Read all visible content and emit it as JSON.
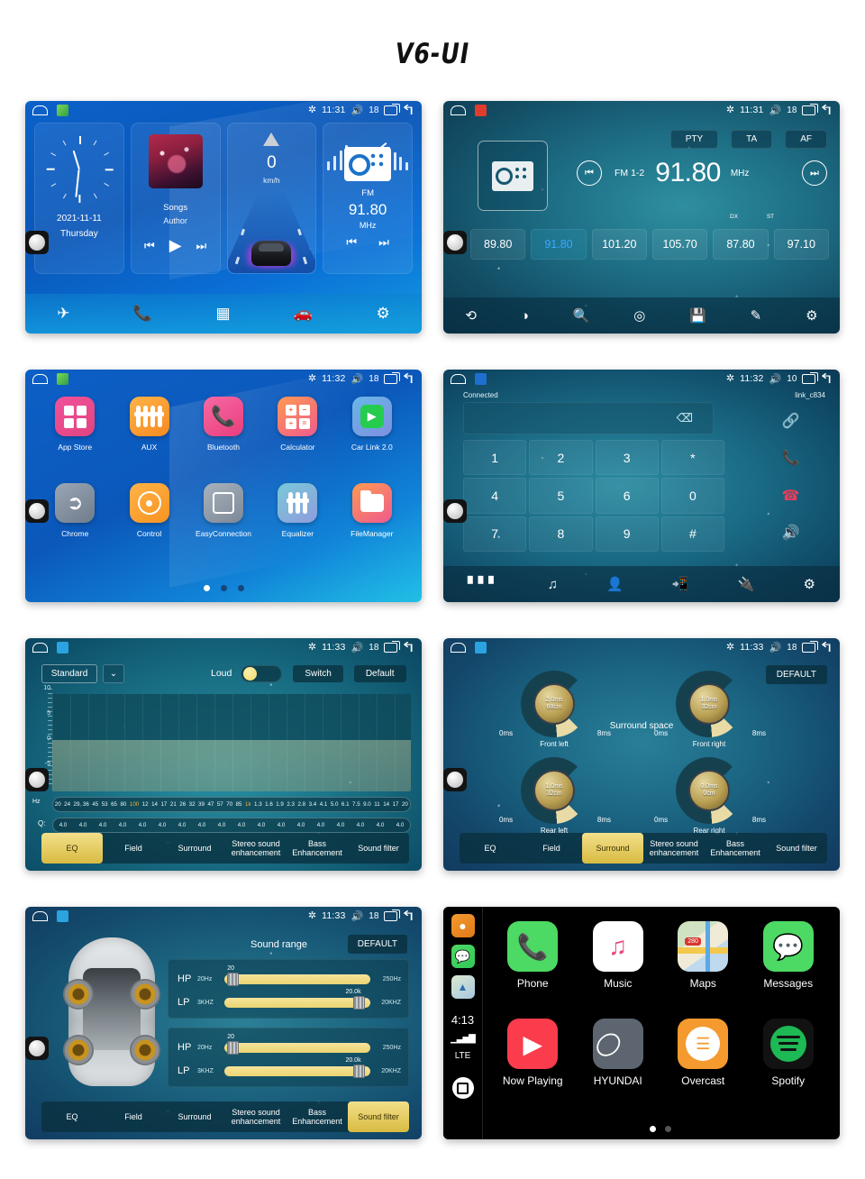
{
  "title": "V6-UI",
  "panels": {
    "home": {
      "status": {
        "time": "11:31",
        "volume": "18",
        "bt_icon": "bluetooth-icon",
        "vol_icon": "volume-icon"
      },
      "clock": {
        "date": "2021-11-11",
        "weekday": "Thursday"
      },
      "music": {
        "song": "Songs",
        "artist": "Author"
      },
      "nav": {
        "speed": "0",
        "unit": "km/h"
      },
      "radio": {
        "band": "FM",
        "freq": "91.80",
        "unit": "MHz"
      },
      "dock": [
        "navigation-icon",
        "phone-icon",
        "apps-icon",
        "carlink-icon",
        "settings-icon"
      ]
    },
    "radio": {
      "status": {
        "time": "11:31",
        "volume": "18"
      },
      "buttons": [
        "PTY",
        "TA",
        "AF"
      ],
      "band": "FM 1-2",
      "frequency": "91.80",
      "unit": "MHz",
      "dx": "DX",
      "st": "ST",
      "presets": [
        "89.80",
        "91.80",
        "101.20",
        "105.70",
        "87.80",
        "97.10"
      ],
      "active_preset_index": 1,
      "dock": [
        "scan-icon",
        "mode-icon",
        "search-icon",
        "location-icon",
        "save-icon",
        "edit-icon",
        "settings-icon"
      ]
    },
    "apps": {
      "status": {
        "time": "11:32",
        "volume": "18"
      },
      "items": [
        {
          "label": "App Store",
          "icon": "grid-icon",
          "color1": "#f0529b",
          "color2": "#e2437f"
        },
        {
          "label": "AUX",
          "icon": "sliders-icon",
          "color1": "#ffb347",
          "color2": "#f58a21"
        },
        {
          "label": "Bluetooth",
          "icon": "phone-icon",
          "color1": "#f56aa3",
          "color2": "#ea3d7d"
        },
        {
          "label": "Calculator",
          "icon": "calculator-icon",
          "color1": "#ff9a52",
          "color2": "#ee5a8e"
        },
        {
          "label": "Car Link 2.0",
          "icon": "play-icon",
          "color1": "#67b7e8",
          "color2": "#7f8fe0"
        },
        {
          "label": "Chrome",
          "icon": "compass-icon",
          "color1": "#9aa6b4",
          "color2": "#6f7c8c"
        },
        {
          "label": "Control",
          "icon": "steering-wheel-icon",
          "color1": "#ffb347",
          "color2": "#f79321"
        },
        {
          "label": "EasyConnection",
          "icon": "screen-share-icon",
          "color1": "#a7b2bd",
          "color2": "#7d8896"
        },
        {
          "label": "Equalizer",
          "icon": "equalizer-icon",
          "color1": "#79c8d8",
          "color2": "#8f9ddd"
        },
        {
          "label": "FileManager",
          "icon": "folder-icon",
          "color1": "#ff9a52",
          "color2": "#ee5a8e"
        }
      ],
      "page_dots": 3,
      "active_dot": 0
    },
    "dialer": {
      "status": {
        "time": "11:32",
        "volume": "10"
      },
      "connection_status": "Connected",
      "device_name": "link_c834",
      "input_value": "",
      "keys": [
        "1",
        "2",
        "3",
        "*",
        "4",
        "5",
        "6",
        "0",
        "7",
        "8",
        "9",
        "#"
      ],
      "side_buttons": [
        "link-icon",
        "call-answer-icon",
        "call-end-icon",
        "speaker-icon"
      ],
      "dock": [
        "dialpad-icon",
        "music-icon",
        "contacts-icon",
        "call-log-icon",
        "connect-icon",
        "settings-icon"
      ]
    },
    "eq": {
      "status": {
        "time": "11:33",
        "volume": "18"
      },
      "preset": "Standard",
      "loud_label": "Loud",
      "loud_on": true,
      "switch_label": "Switch",
      "default_label": "Default",
      "y_axis": [
        "10",
        "5",
        "0",
        "-5"
      ],
      "hz_label": "Hz",
      "q_label": "Q:",
      "frequencies": [
        "20",
        "24",
        "29",
        "36",
        "45",
        "53",
        "65",
        "80",
        "100",
        "12",
        "14",
        "17",
        "21",
        "26",
        "32",
        "39",
        "47",
        "57",
        "70",
        "85",
        "1k",
        "1.3",
        "1.6",
        "1.9",
        "2.3",
        "2.8",
        "3.4",
        "4.1",
        "5.0",
        "6.1",
        "7.5",
        "9.0",
        "11",
        "14",
        "17",
        "20"
      ],
      "highlight_freqs": [
        "100",
        "1k"
      ],
      "q_values": [
        "4.0",
        "4.0",
        "4.0",
        "4.0",
        "4.0",
        "4.0",
        "4.0",
        "4.0",
        "4.0",
        "4.0",
        "4.0",
        "4.0",
        "4.0",
        "4.0",
        "4.0",
        "4.0",
        "4.0",
        "4.0"
      ],
      "tabs": [
        "EQ",
        "Field",
        "Surround",
        "Stereo sound enhancement",
        "Bass Enhancement",
        "Sound filter"
      ],
      "active_tab": "EQ"
    },
    "surround": {
      "status": {
        "time": "11:33",
        "volume": "18"
      },
      "default_label": "DEFAULT",
      "center_label": "Surround space",
      "knobs": [
        {
          "label": "Front left",
          "delay": "2.0ms",
          "distance": "68cm",
          "min": "0ms",
          "max": "8ms"
        },
        {
          "label": "Front right",
          "delay": "1.0ms",
          "distance": "32cm",
          "min": "0ms",
          "max": "8ms"
        },
        {
          "label": "Rear left",
          "delay": "1.0ms",
          "distance": "32cm",
          "min": "0ms",
          "max": "8ms"
        },
        {
          "label": "Rear right",
          "delay": "0.0ms",
          "distance": "0cm",
          "min": "0ms",
          "max": "8ms"
        }
      ],
      "tabs": [
        "EQ",
        "Field",
        "Surround",
        "Stereo sound enhancement",
        "Bass Enhancement",
        "Sound filter"
      ],
      "active_tab": "Surround"
    },
    "filter": {
      "status": {
        "time": "11:33",
        "volume": "18"
      },
      "title": "Sound range",
      "default_label": "DEFAULT",
      "groups": [
        {
          "rows": [
            {
              "tag": "HP",
              "min": "20Hz",
              "max": "250Hz",
              "value": "20",
              "fill": 8
            },
            {
              "tag": "LP",
              "min": "3KHZ",
              "max": "20KHZ",
              "value": "20.0k",
              "fill": 95
            }
          ]
        },
        {
          "rows": [
            {
              "tag": "HP",
              "min": "20Hz",
              "max": "250Hz",
              "value": "20",
              "fill": 8
            },
            {
              "tag": "LP",
              "min": "3KHZ",
              "max": "20KHZ",
              "value": "20.0k",
              "fill": 95
            }
          ]
        }
      ],
      "tabs": [
        "EQ",
        "Field",
        "Surround",
        "Stereo sound enhancement",
        "Bass Enhancement",
        "Sound filter"
      ],
      "active_tab": "Sound filter"
    },
    "carplay": {
      "time": "4:13",
      "network": "LTE",
      "signal_icon": "signal-bars-icon",
      "rail_icons": [
        "overcast-icon",
        "messages-icon",
        "maps-icon"
      ],
      "home_icon": "carplay-home-icon",
      "apps": [
        {
          "label": "Phone",
          "icon": "phone-icon"
        },
        {
          "label": "Music",
          "icon": "music-note-icon"
        },
        {
          "label": "Maps",
          "icon": "maps-icon"
        },
        {
          "label": "Messages",
          "icon": "message-bubble-icon"
        },
        {
          "label": "Now Playing",
          "icon": "play-icon"
        },
        {
          "label": "HYUNDAI",
          "icon": "hyundai-logo-icon"
        },
        {
          "label": "Overcast",
          "icon": "overcast-icon"
        },
        {
          "label": "Spotify",
          "icon": "spotify-icon"
        }
      ],
      "page_dots": 2,
      "active_dot": 0,
      "maps_badge": "280"
    }
  }
}
